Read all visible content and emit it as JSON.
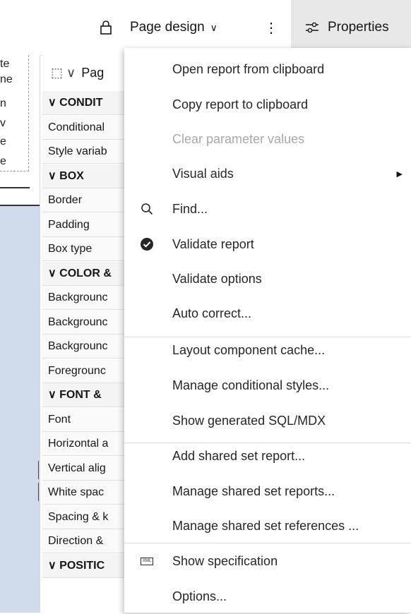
{
  "toolbar": {
    "lock_icon": "lock-icon",
    "page_design_label": "Page design",
    "kebab_label": "⋮",
    "properties_label": "Properties"
  },
  "left_strip": {
    "fragments": [
      "te",
      "ne",
      "n",
      "v",
      "e",
      "e"
    ]
  },
  "properties_panel": {
    "header_label": "Pag",
    "rows": [
      {
        "label": "CONDIT",
        "section": true
      },
      {
        "label": "Conditional",
        "section": false
      },
      {
        "label": "Style variab",
        "section": false
      },
      {
        "label": "BOX",
        "section": true
      },
      {
        "label": "Border",
        "section": false
      },
      {
        "label": "Padding",
        "section": false
      },
      {
        "label": "Box type",
        "section": false
      },
      {
        "label": "COLOR &",
        "section": true
      },
      {
        "label": "Backgrounc",
        "section": false
      },
      {
        "label": "Backgrounc",
        "section": false
      },
      {
        "label": "Backgrounc",
        "section": false
      },
      {
        "label": "Foregrounc",
        "section": false
      },
      {
        "label": "FONT &",
        "section": true
      },
      {
        "label": "Font",
        "section": false
      },
      {
        "label": "Horizontal a",
        "section": false
      },
      {
        "label": "Vertical alig",
        "section": false
      },
      {
        "label": "White spac",
        "section": false
      },
      {
        "label": "Spacing & k",
        "section": false
      },
      {
        "label": "Direction &",
        "section": false
      },
      {
        "label": "POSITIC",
        "section": true
      }
    ]
  },
  "menu": {
    "items": [
      {
        "label": "Open report from clipboard",
        "icon": "",
        "disabled": false,
        "submenu": false
      },
      {
        "label": "Copy report to clipboard",
        "icon": "",
        "disabled": false,
        "submenu": false
      },
      {
        "label": "Clear parameter values",
        "icon": "",
        "disabled": true,
        "submenu": false
      },
      {
        "label": "Visual aids",
        "icon": "",
        "disabled": false,
        "submenu": true
      },
      {
        "label": "Find...",
        "icon": "search-icon",
        "disabled": false,
        "submenu": false
      },
      {
        "label": "Validate report",
        "icon": "checkmark-filled-icon",
        "disabled": false,
        "submenu": false
      },
      {
        "label": "Validate options",
        "icon": "",
        "disabled": false,
        "submenu": false
      },
      {
        "label": "Auto correct...",
        "icon": "",
        "disabled": false,
        "submenu": false
      },
      {
        "label": "Layout component cache...",
        "icon": "",
        "disabled": false,
        "submenu": false
      },
      {
        "label": "Manage conditional styles...",
        "icon": "",
        "disabled": false,
        "submenu": false
      },
      {
        "label": "Show generated SQL/MDX",
        "icon": "",
        "disabled": false,
        "submenu": false
      },
      {
        "label": "Add shared set report...",
        "icon": "",
        "disabled": false,
        "submenu": false
      },
      {
        "label": "Manage shared set reports...",
        "icon": "",
        "disabled": false,
        "submenu": false
      },
      {
        "label": "Manage shared set references ...",
        "icon": "",
        "disabled": false,
        "submenu": false
      },
      {
        "label": "Show specification",
        "icon": "xml-icon",
        "disabled": false,
        "submenu": false
      },
      {
        "label": "Options...",
        "icon": "",
        "disabled": false,
        "submenu": false
      }
    ],
    "xml_icon_text": "XML"
  },
  "colors": {
    "accent_bg": "#e8e8e8",
    "disabled_text": "#a8a8a8",
    "canvas_blue": "#d0dceb"
  }
}
